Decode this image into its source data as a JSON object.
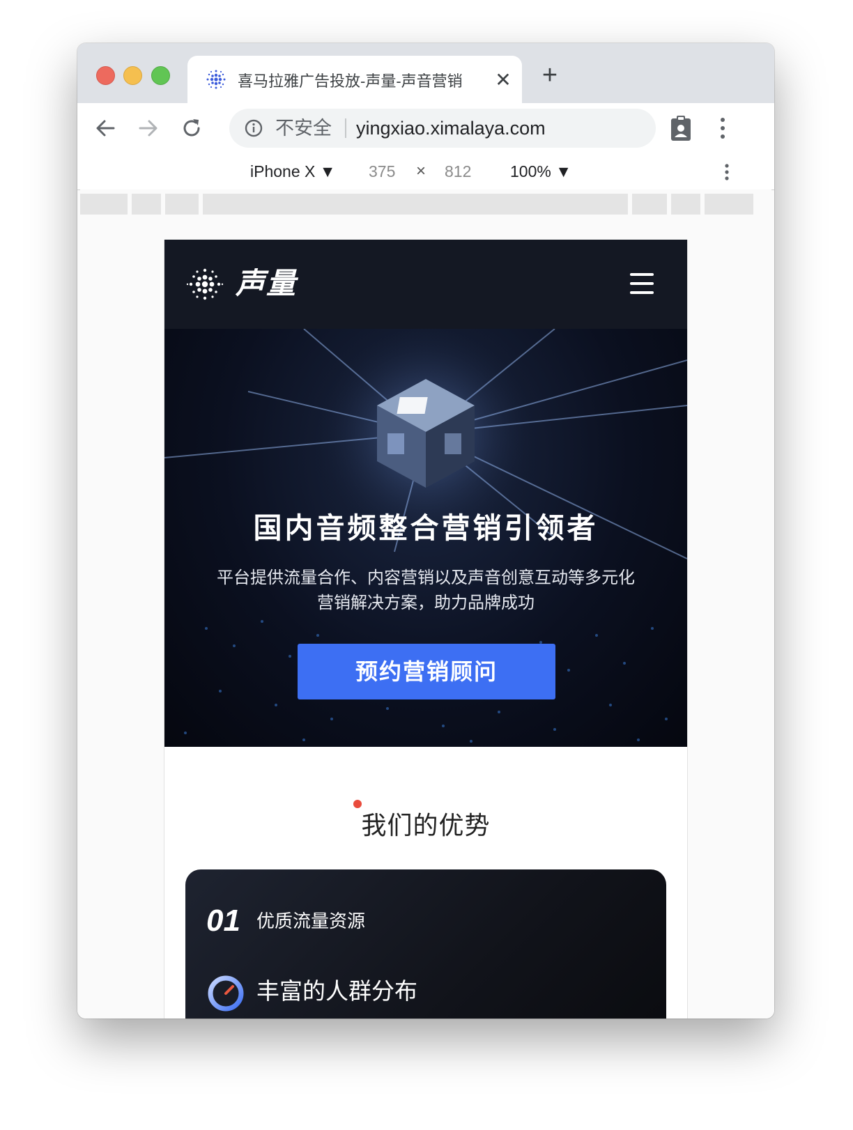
{
  "browser": {
    "tab": {
      "title": "喜马拉雅广告投放-声量-声音营销",
      "close_glyph": "✕"
    },
    "new_tab_glyph": "+",
    "omnibox": {
      "security_label": "不安全",
      "url": "yingxiao.ximalaya.com"
    }
  },
  "device_toolbar": {
    "device": "iPhone X ▼",
    "width": "375",
    "times": "×",
    "height": "812",
    "zoom": "100% ▼"
  },
  "site": {
    "brand_name": "声量",
    "hero": {
      "title": "国内音频整合营销引领者",
      "subtitle": "平台提供流量合作、内容营销以及声音创意互动等多元化营销解决方案，助力品牌成功",
      "cta": "预约营销顾问"
    },
    "section": {
      "title": "我们的优势"
    },
    "advantages": [
      {
        "num": "01",
        "label": "优质流量资源"
      },
      {
        "label": "丰富的人群分布"
      }
    ]
  },
  "colors": {
    "accent": "#3d6ff3",
    "header_bg": "#141823",
    "section_dot": "#e94b3c"
  }
}
